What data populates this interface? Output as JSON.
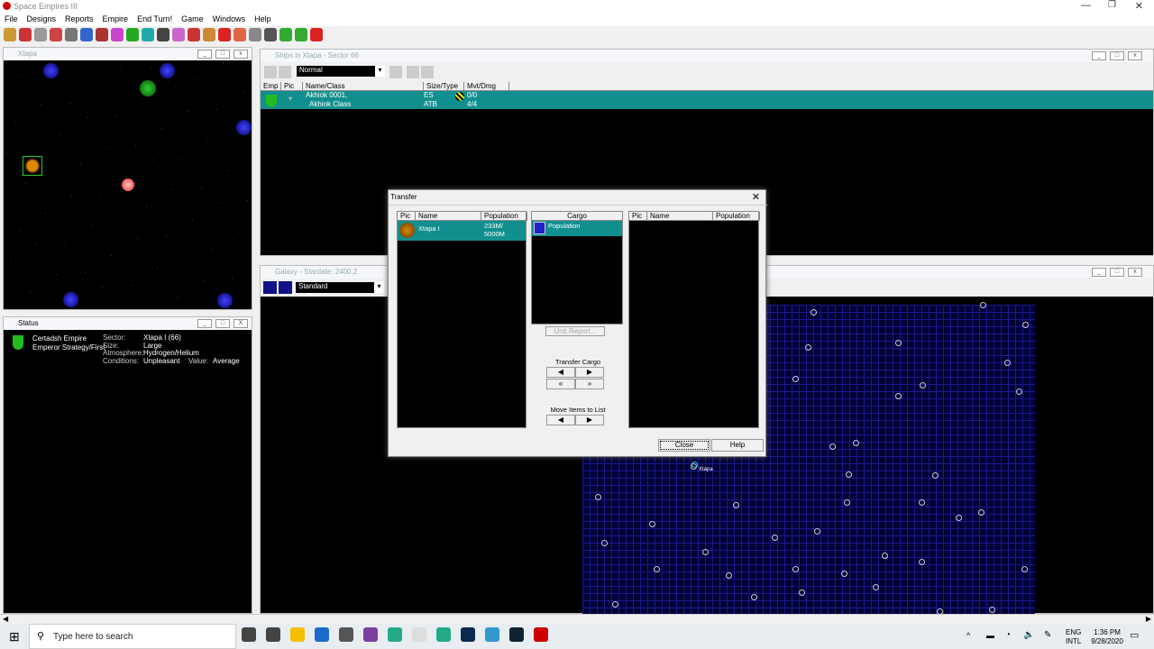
{
  "app": {
    "title": "Space Empires III",
    "menu": [
      "File",
      "Designs",
      "Reports",
      "Empire",
      "End Turn!",
      "Game",
      "Windows",
      "Help"
    ]
  },
  "toolbar_icons": [
    "colonize-icon",
    "cargo-icon",
    "ship-icon",
    "fleet-icon",
    "base-icon",
    "planet-icon",
    "empire-icon",
    "pie-icon",
    "money-icon",
    "research-icon",
    "intel-icon",
    "diplomacy-icon",
    "log-icon",
    "construction-icon",
    "ships-icon",
    "graph-icon",
    "report-icon",
    "grid-icon",
    "prev-icon",
    "next-icon",
    "end-turn-icon"
  ],
  "system_window": {
    "title": "Xtapa"
  },
  "ships_window": {
    "title": "Ships in Xtapa - Sector 66",
    "filter": "Normal",
    "columns": [
      "Emp",
      "Pic",
      "Name/Class",
      "Size/Type",
      "Mvt/Dmg"
    ],
    "rows": [
      {
        "name": "Akhiok 0001,",
        "class": "Akhiok Class",
        "size": "ES",
        "type": "ATB",
        "mvt": "0/0",
        "dmg": "4/4"
      }
    ]
  },
  "status_window": {
    "title": "Status",
    "empire": "Certadsh Empire",
    "strategy": "Emperor Strategy/First",
    "labels": [
      "Sector:",
      "Size:",
      "Atmosphere:",
      "Conditions:"
    ],
    "values": [
      "Xtapa I (66)",
      "Large",
      "Hydrogen/Helium",
      "Unpleasant"
    ],
    "value_label": "Value:",
    "value": "Average"
  },
  "galaxy_window": {
    "title": "Galaxy - Stardate: 2400.2",
    "view": "Standard",
    "system_label": "Xtapa"
  },
  "transfer": {
    "title": "Transfer",
    "left_columns": [
      "Pic",
      "Name",
      "Population"
    ],
    "left_rows": [
      {
        "name": "Xtapa I",
        "population": "233M/\n5000M"
      }
    ],
    "cargo_header": "Cargo",
    "cargo_items": [
      "Population"
    ],
    "unit_report": "Unit Report...",
    "transfer_cargo": "Transfer Cargo",
    "move_items": "Move Items to List",
    "right_columns": [
      "Pic",
      "Name",
      "Population"
    ],
    "close": "Close",
    "help": "Help"
  },
  "taskbar": {
    "search_placeholder": "Type here to search",
    "lang1": "ENG",
    "lang2": "INTL",
    "time": "1:36 PM",
    "date": "9/28/2020"
  }
}
